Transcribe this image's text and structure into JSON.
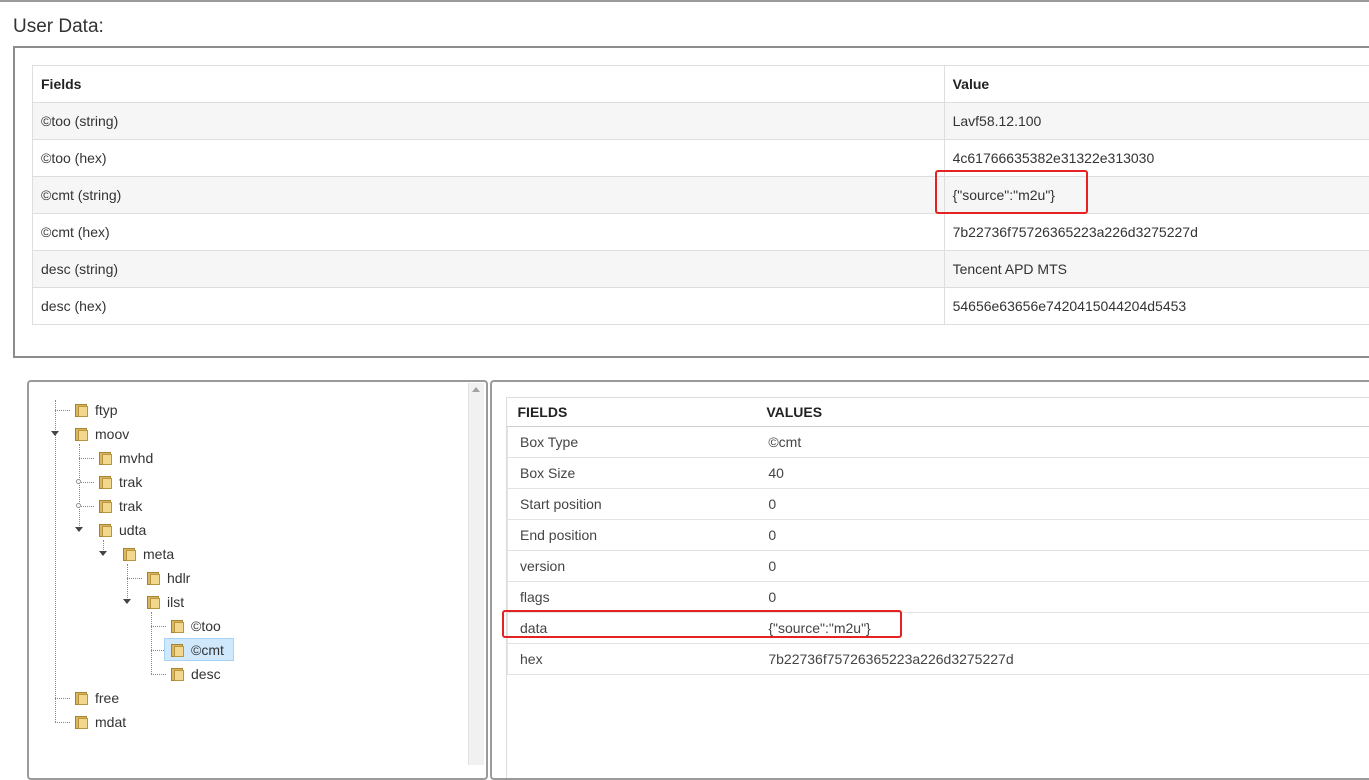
{
  "section_title": "User Data:",
  "user_data_table": {
    "headers": [
      "Fields",
      "Value"
    ],
    "rows": [
      {
        "field": "©too (string)",
        "value": "Lavf58.12.100"
      },
      {
        "field": "©too (hex)",
        "value": "4c61766635382e31322e313030"
      },
      {
        "field": "©cmt (string)",
        "value": "{\"source\":\"m2u\"}"
      },
      {
        "field": "©cmt (hex)",
        "value": "7b22736f75726365223a226d3275227d"
      },
      {
        "field": "desc (string)",
        "value": "Tencent APD MTS"
      },
      {
        "field": "desc (hex)",
        "value": "54656e63656e7420415044204d5453"
      }
    ]
  },
  "tree": {
    "nodes": [
      {
        "label": "ftyp"
      },
      {
        "label": "moov"
      },
      {
        "label": "mvhd"
      },
      {
        "label": "trak"
      },
      {
        "label": "trak"
      },
      {
        "label": "udta"
      },
      {
        "label": "meta"
      },
      {
        "label": "hdlr"
      },
      {
        "label": "ilst"
      },
      {
        "label": "©too"
      },
      {
        "label": "©cmt",
        "selected": true
      },
      {
        "label": "desc"
      },
      {
        "label": "free"
      },
      {
        "label": "mdat"
      }
    ]
  },
  "box_fields_table": {
    "headers": [
      "FIELDS",
      "VALUES"
    ],
    "rows": [
      {
        "field": "Box Type",
        "value": "©cmt"
      },
      {
        "field": "Box Size",
        "value": "40"
      },
      {
        "field": "Start position",
        "value": "0"
      },
      {
        "field": "End position",
        "value": "0"
      },
      {
        "field": "version",
        "value": "0"
      },
      {
        "field": "flags",
        "value": "0"
      },
      {
        "field": "data",
        "value": "{\"source\":\"m2u\"}"
      },
      {
        "field": "hex",
        "value": "7b22736f75726365223a226d3275227d"
      }
    ]
  },
  "colors": {
    "highlight_box": "#e52222",
    "selected_node": "#cfe8fc",
    "folder_icon": "#dcb560"
  }
}
